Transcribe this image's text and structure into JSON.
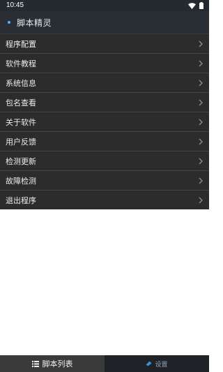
{
  "status_bar": {
    "time": "10:45",
    "icons": [
      "wifi-icon",
      "battery-icon"
    ]
  },
  "header": {
    "title": "脚本精灵",
    "accent_color": "#5ab3e8"
  },
  "menu": {
    "items": [
      {
        "label": "程序配置"
      },
      {
        "label": "软件教程"
      },
      {
        "label": "系统信息"
      },
      {
        "label": "包名查看"
      },
      {
        "label": "关于软件"
      },
      {
        "label": "用户反馈"
      },
      {
        "label": "检测更新"
      },
      {
        "label": "故障检测"
      },
      {
        "label": "退出程序"
      }
    ]
  },
  "tabs": [
    {
      "label": "脚本列表",
      "icon": "list-icon",
      "selected": true
    },
    {
      "label": "设置",
      "icon": "settings-icon",
      "selected": false
    }
  ]
}
